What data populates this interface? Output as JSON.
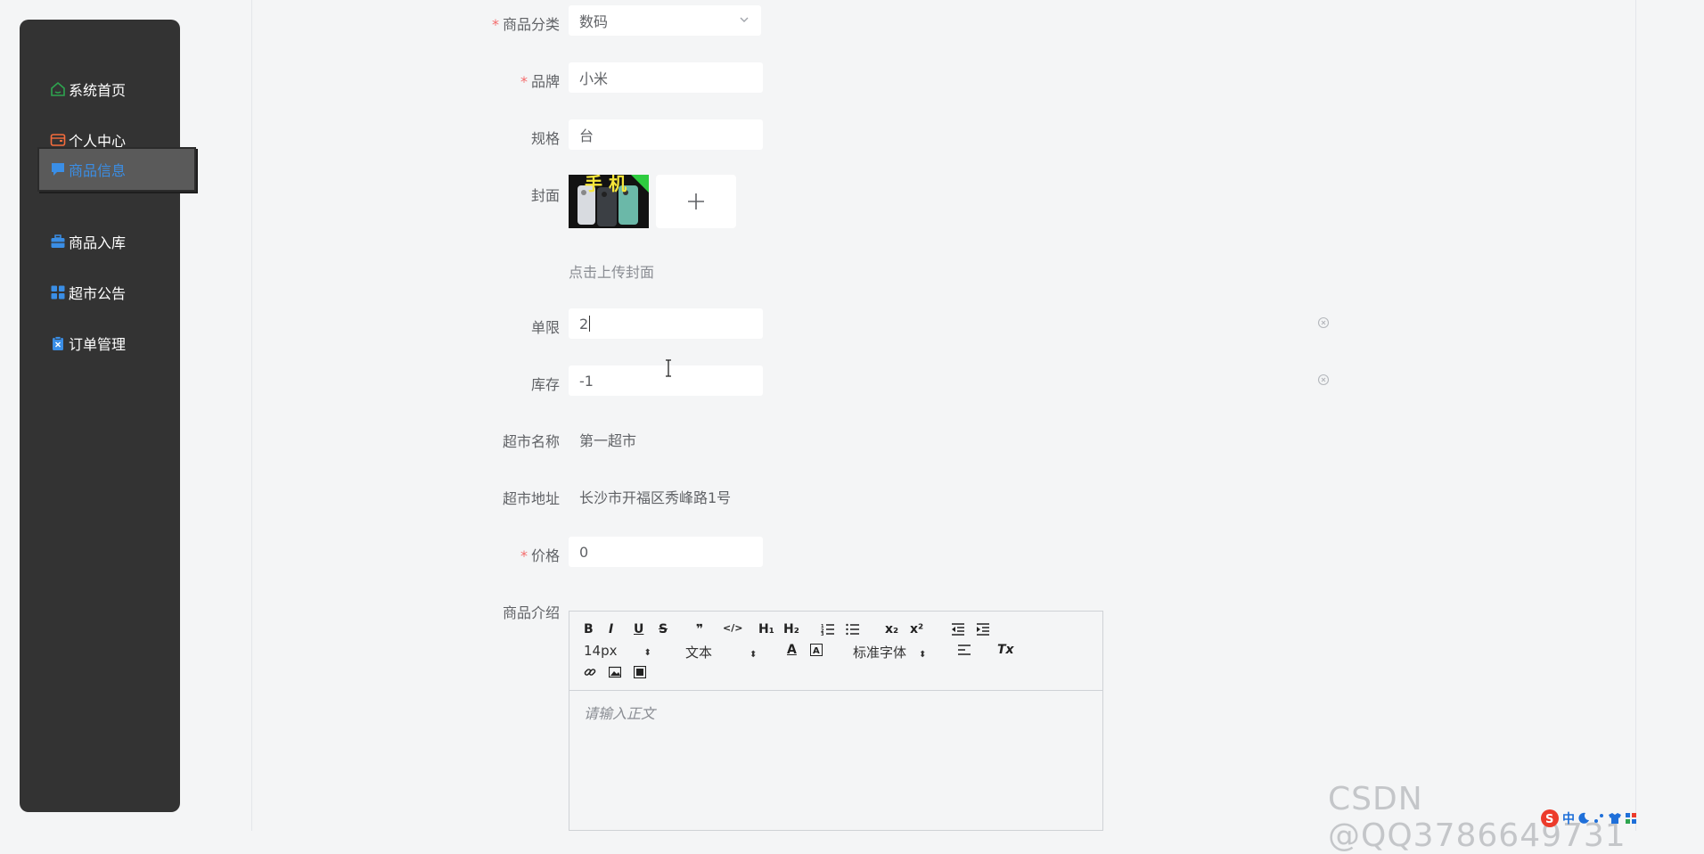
{
  "sidebar": {
    "items": [
      {
        "label": "系统首页",
        "icon": "home-icon",
        "color": "#2ea44f"
      },
      {
        "label": "个人中心",
        "icon": "wallet-icon",
        "color": "#f56c3c"
      },
      {
        "label": "商品信息",
        "icon": "chat-icon",
        "color": "#3a8ee6",
        "active": true
      },
      {
        "label": "商品入库",
        "icon": "briefcase-icon",
        "color": "#3a8ee6"
      },
      {
        "label": "超市公告",
        "icon": "grid-icon",
        "color": "#3a8ee6"
      },
      {
        "label": "订单管理",
        "icon": "clipboard-x-icon",
        "color": "#3a8ee6"
      }
    ]
  },
  "form": {
    "category": {
      "label": "商品分类",
      "value": "数码",
      "required": "*"
    },
    "brand": {
      "label": "品牌",
      "value": "小米",
      "required": "*"
    },
    "spec": {
      "label": "规格",
      "value": "台"
    },
    "cover": {
      "label": "封面",
      "hint": "点击上传封面",
      "image_text": "手 机"
    },
    "limit": {
      "label": "单限",
      "value": "2"
    },
    "stock": {
      "label": "库存",
      "value": "-1"
    },
    "market_name": {
      "label": "超市名称",
      "value": "第一超市"
    },
    "market_address": {
      "label": "超市地址",
      "value": "长沙市开福区秀峰路1号"
    },
    "price": {
      "label": "价格",
      "value": "0",
      "required": "*"
    },
    "intro": {
      "label": "商品介绍"
    }
  },
  "editor": {
    "font_size": "14px",
    "paragraph": "文本",
    "font_family": "标准字体",
    "placeholder": "请输入正文",
    "buttons": {
      "bold": "B",
      "italic": "I",
      "underline": "U",
      "strike": "S",
      "quote": "❞",
      "code": "</>",
      "h1": "H₁",
      "h2": "H₂",
      "sub": "x₂",
      "sup": "x²",
      "color": "A",
      "clean": "Tx"
    }
  },
  "watermark": "CSDN @QQ3786649731",
  "ime": {
    "label": "中"
  }
}
